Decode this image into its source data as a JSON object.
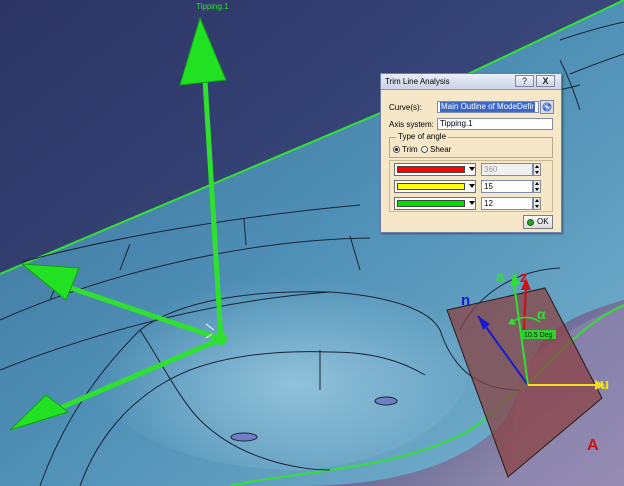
{
  "scene": {
    "axis_label": "Tipping.1",
    "direction_labels": {
      "a": "a",
      "z": "z",
      "n": "n",
      "alpha": "α",
      "u": "u",
      "angle": "10.5 Deg",
      "plane": "A"
    },
    "colors": {
      "background_top": "#2d3a6a",
      "surface": "#3e7fa6",
      "axis_green": "#2fe02f",
      "edge_green": "#35e035",
      "plane_red": "#7a3a3a",
      "label_red": "#cc1111",
      "label_blue": "#1a1acc",
      "label_yellow": "#f0e020"
    }
  },
  "dialog": {
    "title": "Trim Line Analysis",
    "help_label": "?",
    "close_label": "X",
    "curves_label": "Curve(s):",
    "curves_value": "Main Outline of ModeDefir",
    "axis_label": "Axis system:",
    "axis_value": "Tipping.1",
    "angle_group_label": "Type of angle",
    "trim_label": "Trim",
    "shear_label": "Shear",
    "selected_angle_type": "Trim",
    "rows": [
      {
        "color": "#ff0000",
        "value": "360",
        "disabled": true
      },
      {
        "color": "#ffff00",
        "value": "15",
        "disabled": false
      },
      {
        "color": "#00e000",
        "value": "12",
        "disabled": false
      }
    ],
    "ok_label": "OK"
  }
}
